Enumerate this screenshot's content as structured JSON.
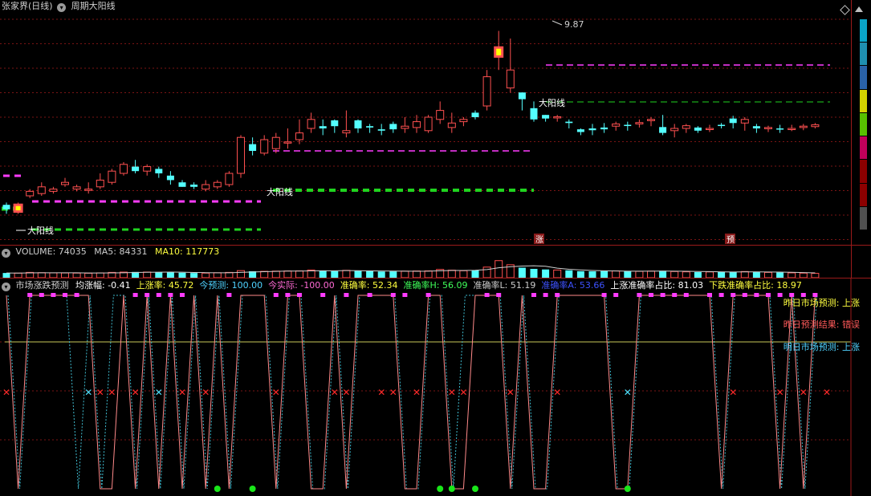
{
  "main": {
    "stock_name": "张家界(日线)",
    "indicator": "周期大阳线",
    "peak_label": "9.87",
    "big_yang_label": "大阳线",
    "rise_marker": "涨",
    "predict_marker": "预"
  },
  "volume": {
    "title": "VOLUME:",
    "value": "74035",
    "ma5_label": "MA5:",
    "ma5": "84331",
    "ma10_label": "MA10:",
    "ma10": "117773"
  },
  "forecast": {
    "title": "市场涨跌预测",
    "stats": [
      {
        "label": "均涨幅:",
        "value": "-0.41",
        "color": "#ffffff"
      },
      {
        "label": "上涨率:",
        "value": "45.72",
        "color": "#ffff3f"
      },
      {
        "label": "今预测:",
        "value": "100.00",
        "color": "#4fd2ff"
      },
      {
        "label": "今实际:",
        "value": "-100.00",
        "color": "#ff6ad5"
      },
      {
        "label": "准确率:",
        "value": "52.34",
        "color": "#ffff3f"
      },
      {
        "label": "准确率H:",
        "value": "56.09",
        "color": "#3fff5a"
      },
      {
        "label": "准确率L:",
        "value": "51.19",
        "color": "#cccccc"
      },
      {
        "label": "准确率A:",
        "value": "53.66",
        "color": "#3d52ff"
      },
      {
        "label": "上涨准确率占比:",
        "value": "81.03",
        "color": "#ffffff"
      },
      {
        "label": "下跌准确率占比:",
        "value": "18.97",
        "color": "#ffff3f"
      }
    ],
    "yesterday_forecast": "昨日市场预测: 上涨",
    "yesterday_result": "昨日预测结果: 错误",
    "tomorrow_forecast": "明日市场预测: 上涨"
  },
  "colors": {
    "up_fill": "#000000",
    "up_border": "#ff5050",
    "down_fill": "#54ffff",
    "grid": "#7a1414",
    "magenta": "#ff3cff",
    "green": "#1fd31f",
    "yellow": "#ffff00"
  },
  "sidebar_colors": [
    "#0aa4c8",
    "#1f8fb0",
    "#2a62a8",
    "#d2d200",
    "#58c000",
    "#c0005a",
    "#8a0000",
    "#8c0000",
    "#505050"
  ],
  "chart_data": [
    {
      "type": "candlestick",
      "title": "张家界(日线)",
      "ylim": [
        5.2,
        10.2
      ],
      "x": [
        1,
        2,
        3,
        4,
        5,
        6,
        7,
        8,
        9,
        10,
        11,
        12,
        13,
        14,
        15,
        16,
        17,
        18,
        19,
        20,
        21,
        22,
        23,
        24,
        25,
        26,
        27,
        28,
        29,
        30,
        31,
        32,
        33,
        34,
        35,
        36,
        37,
        38,
        39,
        40,
        41,
        42,
        43,
        44,
        45,
        46,
        47,
        48,
        49,
        50,
        51,
        52,
        53,
        54,
        55,
        56,
        57,
        58,
        59,
        60,
        61,
        62,
        63,
        64,
        65,
        66,
        67,
        68,
        69,
        70
      ],
      "open": [
        6.0,
        5.85,
        6.2,
        6.25,
        6.3,
        6.45,
        6.35,
        6.32,
        6.4,
        6.5,
        6.7,
        6.85,
        6.75,
        6.8,
        6.65,
        6.5,
        6.45,
        6.35,
        6.4,
        6.45,
        6.7,
        7.35,
        7.15,
        7.25,
        7.4,
        7.45,
        7.7,
        7.75,
        7.88,
        7.6,
        7.88,
        7.75,
        7.68,
        7.8,
        7.7,
        7.72,
        7.65,
        7.9,
        7.72,
        7.85,
        8.05,
        8.2,
        9.3,
        8.6,
        8.5,
        8.15,
        8.0,
        7.95,
        7.85,
        7.68,
        7.7,
        7.72,
        7.75,
        7.78,
        7.8,
        7.88,
        7.73,
        7.65,
        7.7,
        7.72,
        7.7,
        7.78,
        7.92,
        7.82,
        7.75,
        7.7,
        7.7,
        7.7,
        7.72,
        7.74
      ],
      "close": [
        5.9,
        6.0,
        6.3,
        6.4,
        6.35,
        6.5,
        6.4,
        6.35,
        6.55,
        6.75,
        6.9,
        6.75,
        6.85,
        6.7,
        6.55,
        6.4,
        6.4,
        6.45,
        6.5,
        6.7,
        7.5,
        7.2,
        7.45,
        7.5,
        7.4,
        7.6,
        7.9,
        7.7,
        7.75,
        7.65,
        7.7,
        7.72,
        7.65,
        7.68,
        7.75,
        7.85,
        7.95,
        8.1,
        7.82,
        7.9,
        7.95,
        8.85,
        9.5,
        9.0,
        8.35,
        7.9,
        7.92,
        7.96,
        7.82,
        7.62,
        7.66,
        7.68,
        7.8,
        7.76,
        7.83,
        7.9,
        7.6,
        7.7,
        7.76,
        7.65,
        7.7,
        7.76,
        7.82,
        7.9,
        7.7,
        7.72,
        7.68,
        7.7,
        7.75,
        7.78
      ],
      "high": [
        6.05,
        6.05,
        6.35,
        6.5,
        6.4,
        6.6,
        6.45,
        6.5,
        6.7,
        6.8,
        6.95,
        7.0,
        6.9,
        6.85,
        6.75,
        6.55,
        6.5,
        6.55,
        6.55,
        6.75,
        7.55,
        7.5,
        7.55,
        7.6,
        7.7,
        7.9,
        8.05,
        7.9,
        7.9,
        8.1,
        7.9,
        7.8,
        7.8,
        7.85,
        7.95,
        8.0,
        8.0,
        8.3,
        8.05,
        7.95,
        8.1,
        9.0,
        9.87,
        9.7,
        8.5,
        8.3,
        8.0,
        8.0,
        7.9,
        7.7,
        7.8,
        7.82,
        7.85,
        7.85,
        7.9,
        7.95,
        8.0,
        7.8,
        7.8,
        7.75,
        7.78,
        7.82,
        7.98,
        7.95,
        7.8,
        7.76,
        7.78,
        7.78,
        7.8,
        7.82
      ],
      "low": [
        5.8,
        5.8,
        6.15,
        6.2,
        6.25,
        6.4,
        6.3,
        6.25,
        6.35,
        6.45,
        6.65,
        6.7,
        6.65,
        6.6,
        6.45,
        6.4,
        6.35,
        6.3,
        6.35,
        6.4,
        6.6,
        7.1,
        7.1,
        7.15,
        7.25,
        7.35,
        7.6,
        7.55,
        7.6,
        7.5,
        7.6,
        7.6,
        7.55,
        7.6,
        7.6,
        7.6,
        7.6,
        7.8,
        7.6,
        7.75,
        7.9,
        8.1,
        9.0,
        8.5,
        8.1,
        7.85,
        7.85,
        7.85,
        7.7,
        7.55,
        7.55,
        7.6,
        7.65,
        7.65,
        7.72,
        7.75,
        7.55,
        7.5,
        7.6,
        7.6,
        7.62,
        7.7,
        7.7,
        7.65,
        7.6,
        7.62,
        7.6,
        7.64,
        7.66,
        7.7
      ]
    },
    {
      "type": "bar",
      "title": "VOLUME",
      "series": [
        {
          "name": "VOLUME",
          "values": [
            80000,
            78000,
            90000,
            85000,
            82000,
            80000,
            78000,
            76000,
            82000,
            90000,
            95000,
            98000,
            96000,
            94000,
            92000,
            85000,
            80000,
            78000,
            84000,
            90000,
            120000,
            110000,
            108000,
            112000,
            114000,
            116000,
            130000,
            118000,
            112000,
            125000,
            115000,
            110000,
            105000,
            108000,
            112000,
            114000,
            116000,
            140000,
            128000,
            118000,
            125000,
            180000,
            290000,
            220000,
            170000,
            150000,
            140000,
            130000,
            125000,
            110000,
            108000,
            112000,
            115000,
            110000,
            108000,
            112000,
            118000,
            105000,
            100000,
            95000,
            98000,
            96000,
            99000,
            105000,
            95000,
            90000,
            88000,
            82000,
            78000,
            74035
          ]
        }
      ]
    }
  ]
}
